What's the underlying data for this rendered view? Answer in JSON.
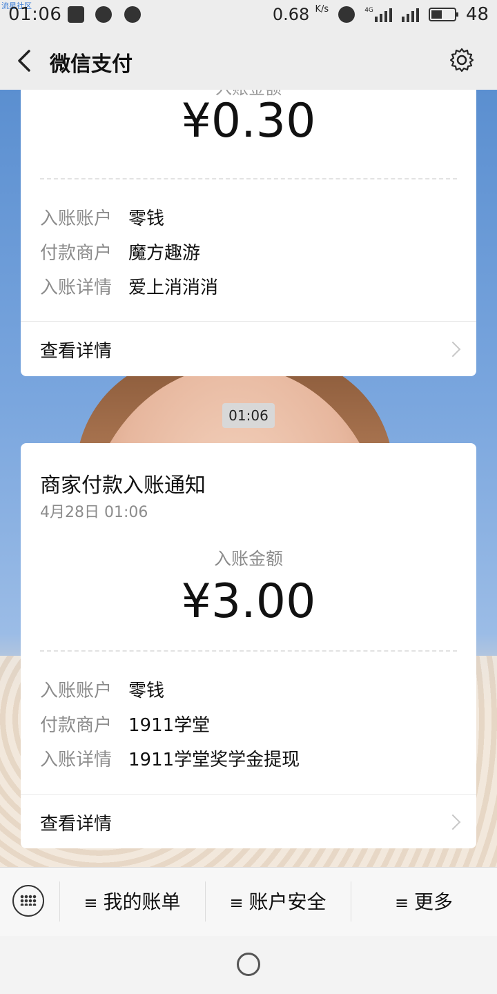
{
  "status_bar": {
    "watermark": "流星社区",
    "time": "01:06",
    "net_speed": "0.68",
    "net_unit": "K/s",
    "net_type": "4G",
    "battery": "48",
    "battery_level_percent": 48,
    "icons": [
      "shield-icon",
      "chat-bubble-icon",
      "pause-icon",
      "alarm-icon",
      "signal-icon",
      "battery-icon"
    ]
  },
  "header": {
    "title": "微信支付",
    "back_icon": "chevron-left-icon",
    "settings_icon": "gear-icon"
  },
  "messages": [
    {
      "partial_label": "入账金额",
      "amount": "¥0.30",
      "rows": [
        {
          "key": "入账账户",
          "value": "零钱"
        },
        {
          "key": "付款商户",
          "value": "魔方趣游"
        },
        {
          "key": "入账详情",
          "value": "爱上消消消"
        }
      ],
      "detail_link": "查看详情"
    },
    {
      "timestamp_pill": "01:06",
      "title": "商家付款入账通知",
      "date": "4月28日  01:06",
      "amount_label": "入账金额",
      "amount": "¥3.00",
      "rows": [
        {
          "key": "入账账户",
          "value": "零钱"
        },
        {
          "key": "付款商户",
          "value": "1911学堂"
        },
        {
          "key": "入账详情",
          "value": "1911学堂奖学金提现"
        }
      ],
      "detail_link": "查看详情"
    }
  ],
  "bottom_menu": {
    "keyboard_icon": "keyboard-icon",
    "items": [
      {
        "label": "我的账单",
        "icon": "hamburger-icon"
      },
      {
        "label": "账户安全",
        "icon": "hamburger-icon"
      },
      {
        "label": "更多",
        "icon": "hamburger-icon"
      }
    ]
  },
  "nav_bar": {
    "home_icon": "home-circle-icon"
  }
}
